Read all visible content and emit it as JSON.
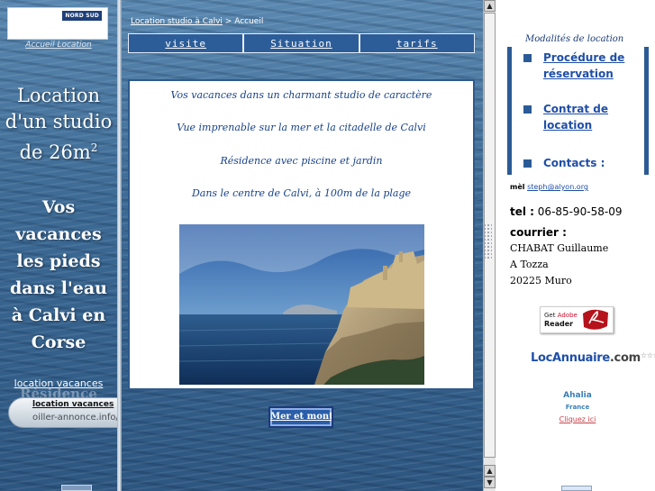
{
  "left": {
    "logo_badge": "NORD SUD",
    "logo_caption": "Accueil Location",
    "title_line1": "Location",
    "title_line2": "d'un studio",
    "title_line3": "de 26m",
    "title_sup": "2",
    "slogan": [
      "Vos",
      "vacances",
      "les pieds",
      "dans l'eau",
      "à Calvi en",
      "Corse"
    ],
    "ad_title": "location vacances",
    "ad_ghost": "Résidence",
    "ad_pill_title": "location vacances",
    "ad_pill_url": "oiller-annonce.info/ le"
  },
  "middle": {
    "breadcrumb_link": "Location studio à Calvi",
    "breadcrumb_sep": " > ",
    "breadcrumb_current": "Accueil",
    "nav": [
      "visite",
      "Situation",
      "tarifs"
    ],
    "lines": [
      "Vos vacances dans un charmant studio de caractère",
      "Vue imprenable sur la mer et la citadelle de Calvi",
      "Résidence avec piscine et jardin",
      "Dans le centre de Calvi, à 100m de la plage"
    ],
    "next_button": "Mer et montagne"
  },
  "right": {
    "title": "Modalités de location",
    "links": [
      {
        "label": "Procédure de réservation"
      },
      {
        "label": "Contrat de location"
      }
    ],
    "contacts_label": "Contacts :",
    "mail_label": "mèl",
    "mail_value": "steph@alyon.org",
    "tel_label": "tel :",
    "tel_value": "06-85-90-58-09",
    "courrier_label": "courrier :",
    "address": [
      "CHABAT Guillaume",
      "A Tozza",
      "20225 Muro"
    ],
    "adobe_get": "Get",
    "adobe_brand": "Adobe",
    "adobe_reader": "Reader",
    "locannuaire_part1": "LocAnnuaire",
    "locannuaire_part2": ".com",
    "locannuaire_stars": "☆☆☆",
    "ahalia_name": "Ahalia",
    "ahalia_country": "France",
    "ahalia_cta": "Cliquez ici"
  },
  "colors": {
    "nav_bg": "#2c5d99",
    "content_text": "#17428a",
    "right_accent": "#2b5b96",
    "link_blue": "#1f4fa8"
  },
  "icons": {
    "bullet": "square-bullet-icon",
    "scroll_up": "arrow-up-icon",
    "scroll_down": "arrow-down-icon"
  }
}
